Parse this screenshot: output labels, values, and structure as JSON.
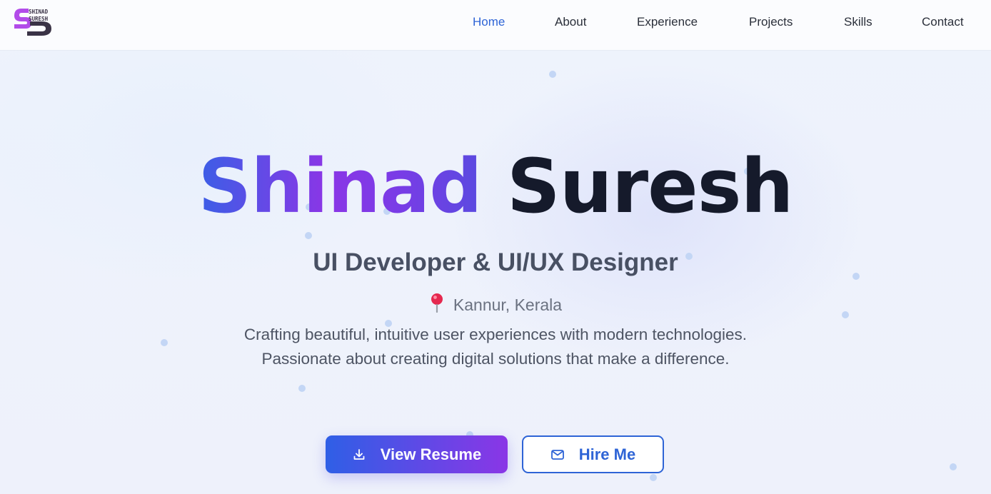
{
  "brand": {
    "logo_text_top": "SHINAD",
    "logo_text_bottom": "SURESH",
    "accent": "#9b3de8",
    "dark": "#3a3346"
  },
  "nav": {
    "items": [
      {
        "label": "Home",
        "active": true
      },
      {
        "label": "About",
        "active": false
      },
      {
        "label": "Experience",
        "active": false
      },
      {
        "label": "Projects",
        "active": false
      },
      {
        "label": "Skills",
        "active": false
      },
      {
        "label": "Contact",
        "active": false
      }
    ],
    "active_color": "#2e64d6"
  },
  "hero": {
    "first_name": "Shinad",
    "last_name": "Suresh",
    "subtitle": "UI Developer & UI/UX Designer",
    "location_icon": "map-pin-icon",
    "location": "Kannur, Kerala",
    "description": "Crafting beautiful, intuitive user experiences with modern technologies. Passionate about creating digital solutions that make a difference."
  },
  "actions": {
    "resume": {
      "label": "View Resume",
      "icon": "download-icon"
    },
    "hire": {
      "label": "Hire Me",
      "icon": "mail-icon"
    }
  },
  "colors": {
    "gradient_start": "#2f5fe6",
    "gradient_end": "#8a36e6",
    "heading_dark": "#151a2b"
  }
}
